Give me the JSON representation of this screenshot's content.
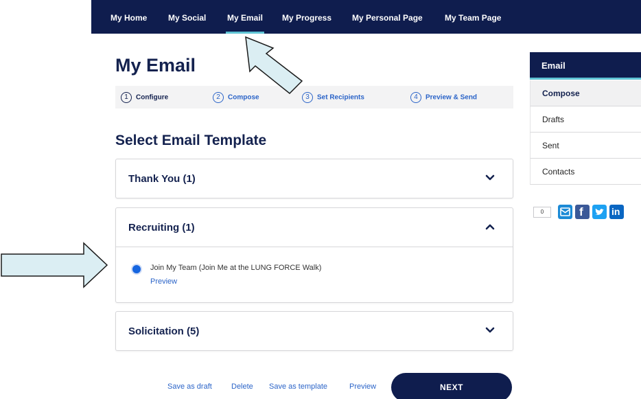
{
  "nav": {
    "items": [
      {
        "label": "My Home"
      },
      {
        "label": "My Social"
      },
      {
        "label": "My Email"
      },
      {
        "label": "My Progress"
      },
      {
        "label": "My Personal Page"
      },
      {
        "label": "My Team Page"
      }
    ],
    "active": "My Email"
  },
  "page": {
    "title": "My Email"
  },
  "steps": [
    {
      "num": "1",
      "label": "Configure"
    },
    {
      "num": "2",
      "label": "Compose"
    },
    {
      "num": "3",
      "label": "Set Recipients"
    },
    {
      "num": "4",
      "label": "Preview & Send"
    }
  ],
  "section": {
    "title": "Select Email Template"
  },
  "accordion": [
    {
      "title": "Thank You (1)",
      "expanded": false
    },
    {
      "title": "Recruiting (1)",
      "expanded": true,
      "option": {
        "label": "Join My Team (Join Me at the LUNG FORCE Walk)",
        "selected": true,
        "preview": "Preview"
      }
    },
    {
      "title": "Solicitation (5)",
      "expanded": false
    }
  ],
  "actions": {
    "save_draft": "Save as draft",
    "delete": "Delete",
    "save_template": "Save as template",
    "preview": "Preview",
    "next": "NEXT"
  },
  "sidebar": {
    "header": "Email",
    "items": [
      {
        "label": "Compose",
        "active": true
      },
      {
        "label": "Drafts"
      },
      {
        "label": "Sent"
      },
      {
        "label": "Contacts"
      }
    ]
  },
  "share": {
    "count": "0",
    "icons": [
      "email-share-icon",
      "facebook-icon",
      "twitter-icon",
      "linkedin-icon"
    ],
    "glyphs": {
      "facebook": "f",
      "linkedin": "in"
    }
  },
  "colors": {
    "navy": "#0f1d4e",
    "accent_teal": "#5fc3d4",
    "link_blue": "#2b64c8",
    "radio_blue": "#1565e0",
    "annotation_fill": "#dbeef3",
    "facebook": "#3b5998",
    "twitter": "#1da1f2",
    "linkedin": "#0a66c2",
    "email_share": "#1c8ad6"
  }
}
